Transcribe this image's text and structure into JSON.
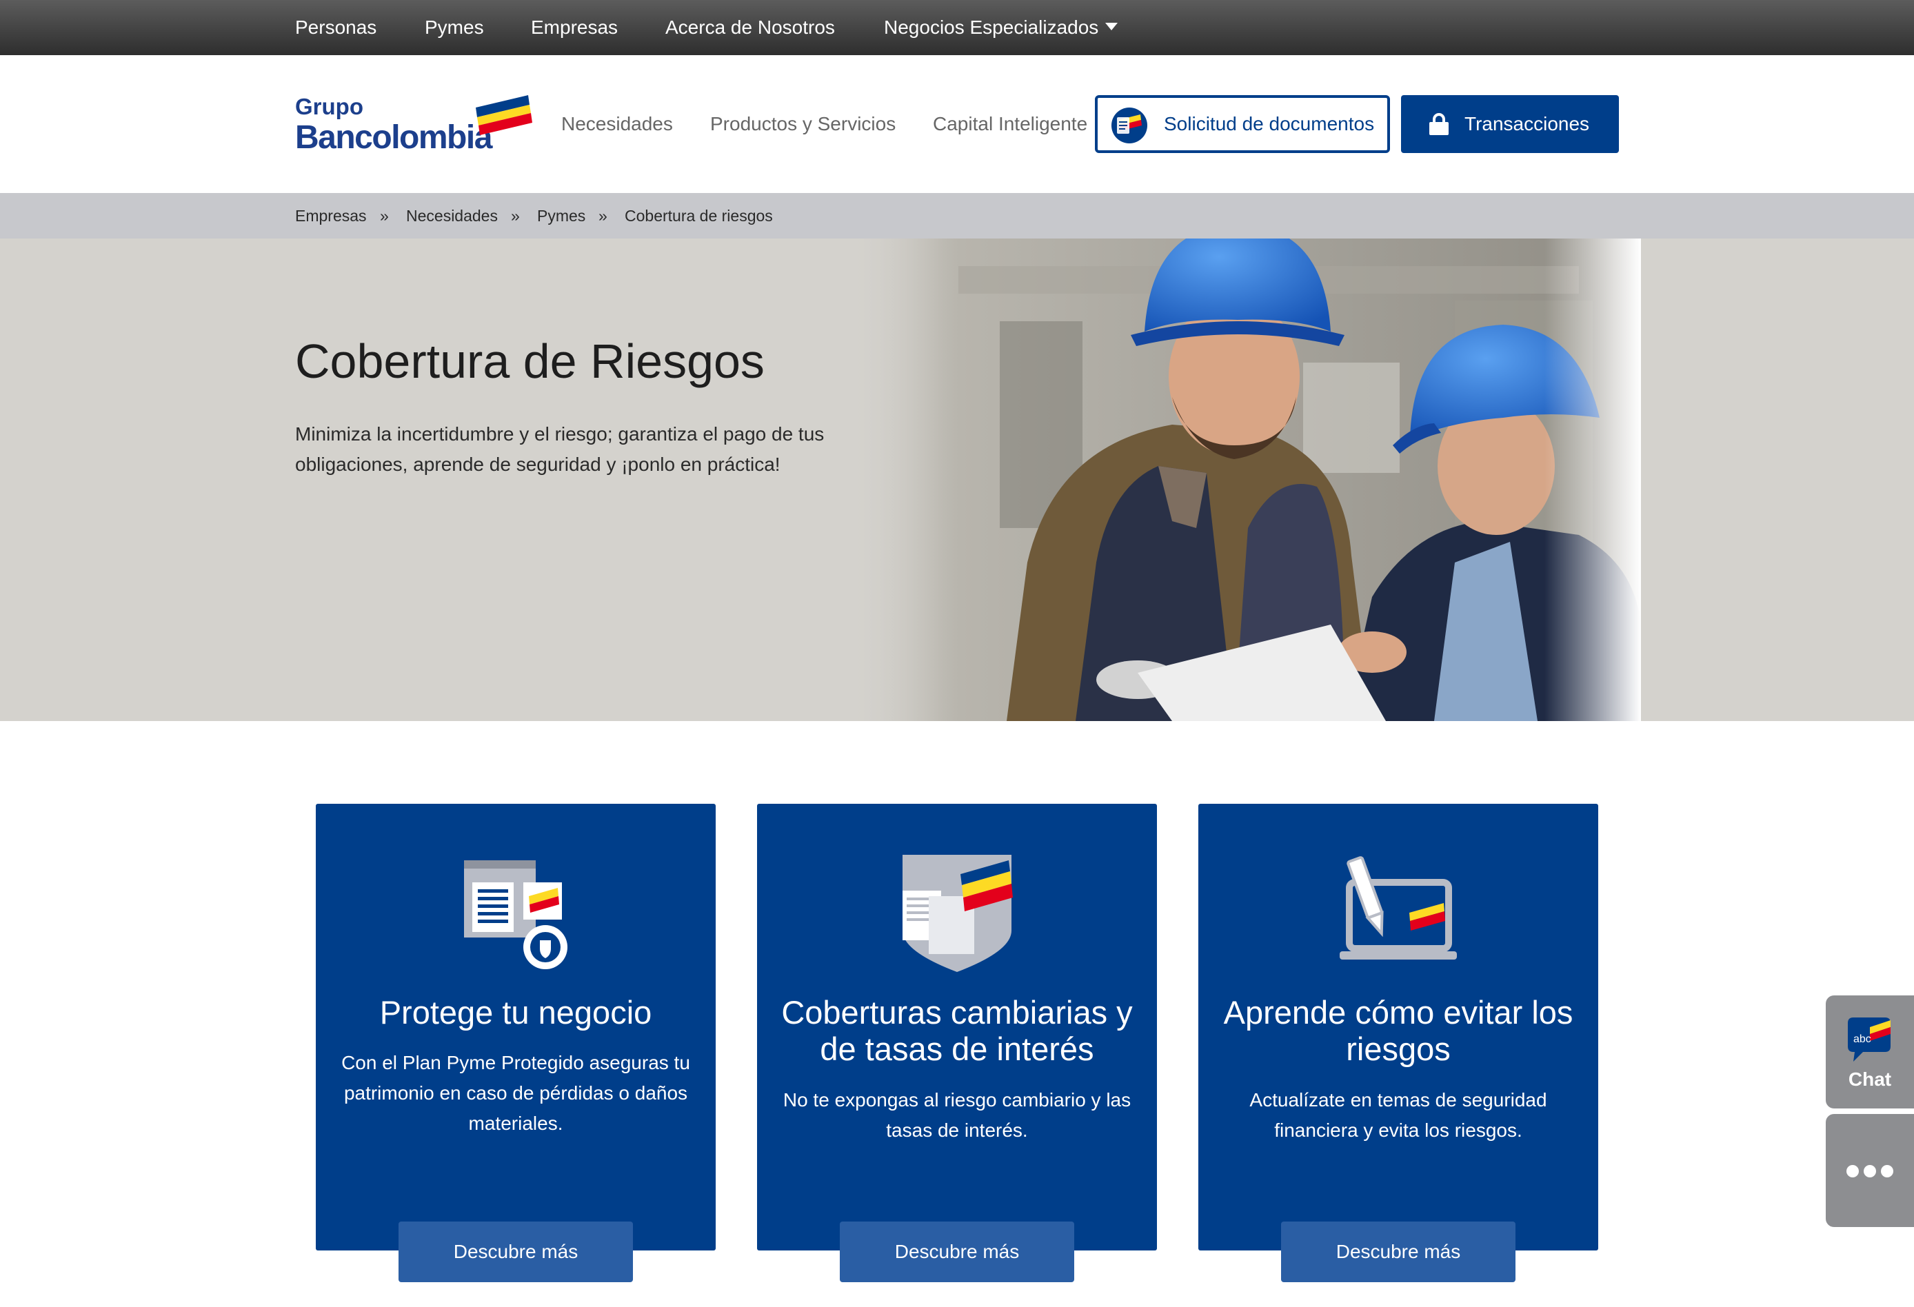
{
  "top_nav": {
    "items": [
      "Personas",
      "Pymes",
      "Empresas",
      "Acerca de Nosotros",
      "Negocios Especializados"
    ]
  },
  "logo": {
    "line1": "Grupo",
    "line2": "Bancolombia"
  },
  "main_nav": {
    "items": [
      "Necesidades",
      "Productos y Servicios",
      "Capital Inteligente"
    ]
  },
  "buttons": {
    "documents": "Solicitud de documentos",
    "transactions": "Transacciones"
  },
  "breadcrumb": {
    "items": [
      "Empresas",
      "Necesidades",
      "Pymes",
      "Cobertura de riesgos"
    ],
    "separator": "»"
  },
  "hero": {
    "title": "Cobertura de Riesgos",
    "description": "Minimiza la incertidumbre y el riesgo; garantiza el pago de tus obligaciones, aprende de seguridad y ¡ponlo en práctica!"
  },
  "cards": [
    {
      "icon": "business-protection-icon",
      "title": "Protege tu negocio",
      "description": "Con el Plan Pyme Protegido aseguras tu patrimonio en caso de pérdidas o daños materiales.",
      "button": "Descubre más"
    },
    {
      "icon": "shield-documents-icon",
      "title": "Coberturas cambiarias y de tasas de interés",
      "description": "No te expongas al riesgo cambiario y las tasas de interés.",
      "button": "Descubre más"
    },
    {
      "icon": "laptop-pen-icon",
      "title": "Aprende cómo evitar los riesgos",
      "description": "Actualízate en temas de seguridad financiera y evita los riesgos.",
      "button": "Descubre más"
    }
  ],
  "chat_widget": {
    "badge": "abc",
    "label": "Chat"
  },
  "colors": {
    "brand_blue": "#003e8a",
    "brand_yellow": "#fdda24",
    "brand_red": "#e3001b",
    "top_bar": "#3c3c3c",
    "breadcrumb_bg": "#c7c8cc",
    "hero_bg": "#d4d2cd"
  }
}
